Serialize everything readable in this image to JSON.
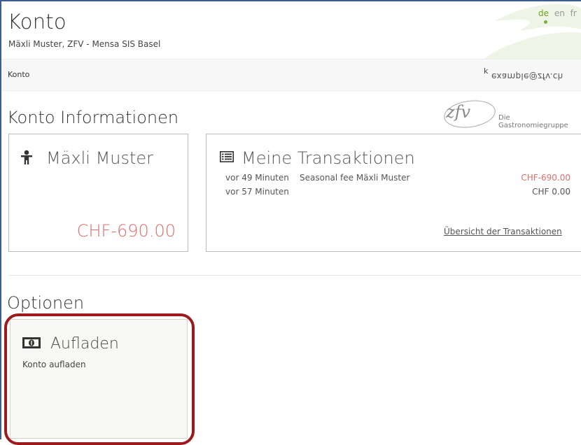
{
  "header": {
    "title": "Konto",
    "subtitle": "Mäxli Muster, ZFV - Mensa SIS Basel",
    "languages": [
      {
        "label": "de",
        "active": true
      },
      {
        "label": "en",
        "active": false
      },
      {
        "label": "fr",
        "active": false
      }
    ]
  },
  "breadcrumb": {
    "current": "Konto",
    "user_prefix": "k",
    "user_email": "example@zfv.ch"
  },
  "account_section": {
    "title": "Konto Informationen",
    "brand_logo": "zfv",
    "brand_tagline": "Die Gastronomiegruppe"
  },
  "user_card": {
    "icon": "person-icon",
    "name": "Mäxli Muster",
    "balance": "CHF-690.00"
  },
  "transactions_card": {
    "icon": "list-icon",
    "title": "Meine Transaktionen",
    "rows": [
      {
        "when": "vor 49 Minuten",
        "description": "Seasonal fee Mäxli Muster",
        "amount": "CHF-690.00",
        "negative": true
      },
      {
        "when": "vor 57 Minuten",
        "description": "",
        "amount": "CHF 0.00",
        "negative": false
      }
    ],
    "overview_link": "Übersicht der Transaktionen"
  },
  "options_section": {
    "title": "Optionen",
    "cards": [
      {
        "icon": "money-icon",
        "title": "Aufladen",
        "description": "Konto aufladen"
      }
    ]
  },
  "colors": {
    "accent_green": "#7ab13a",
    "negative_red": "#e06d6d",
    "highlight_red": "#9c1a1c",
    "frame_blue": "#3a5f8f"
  }
}
